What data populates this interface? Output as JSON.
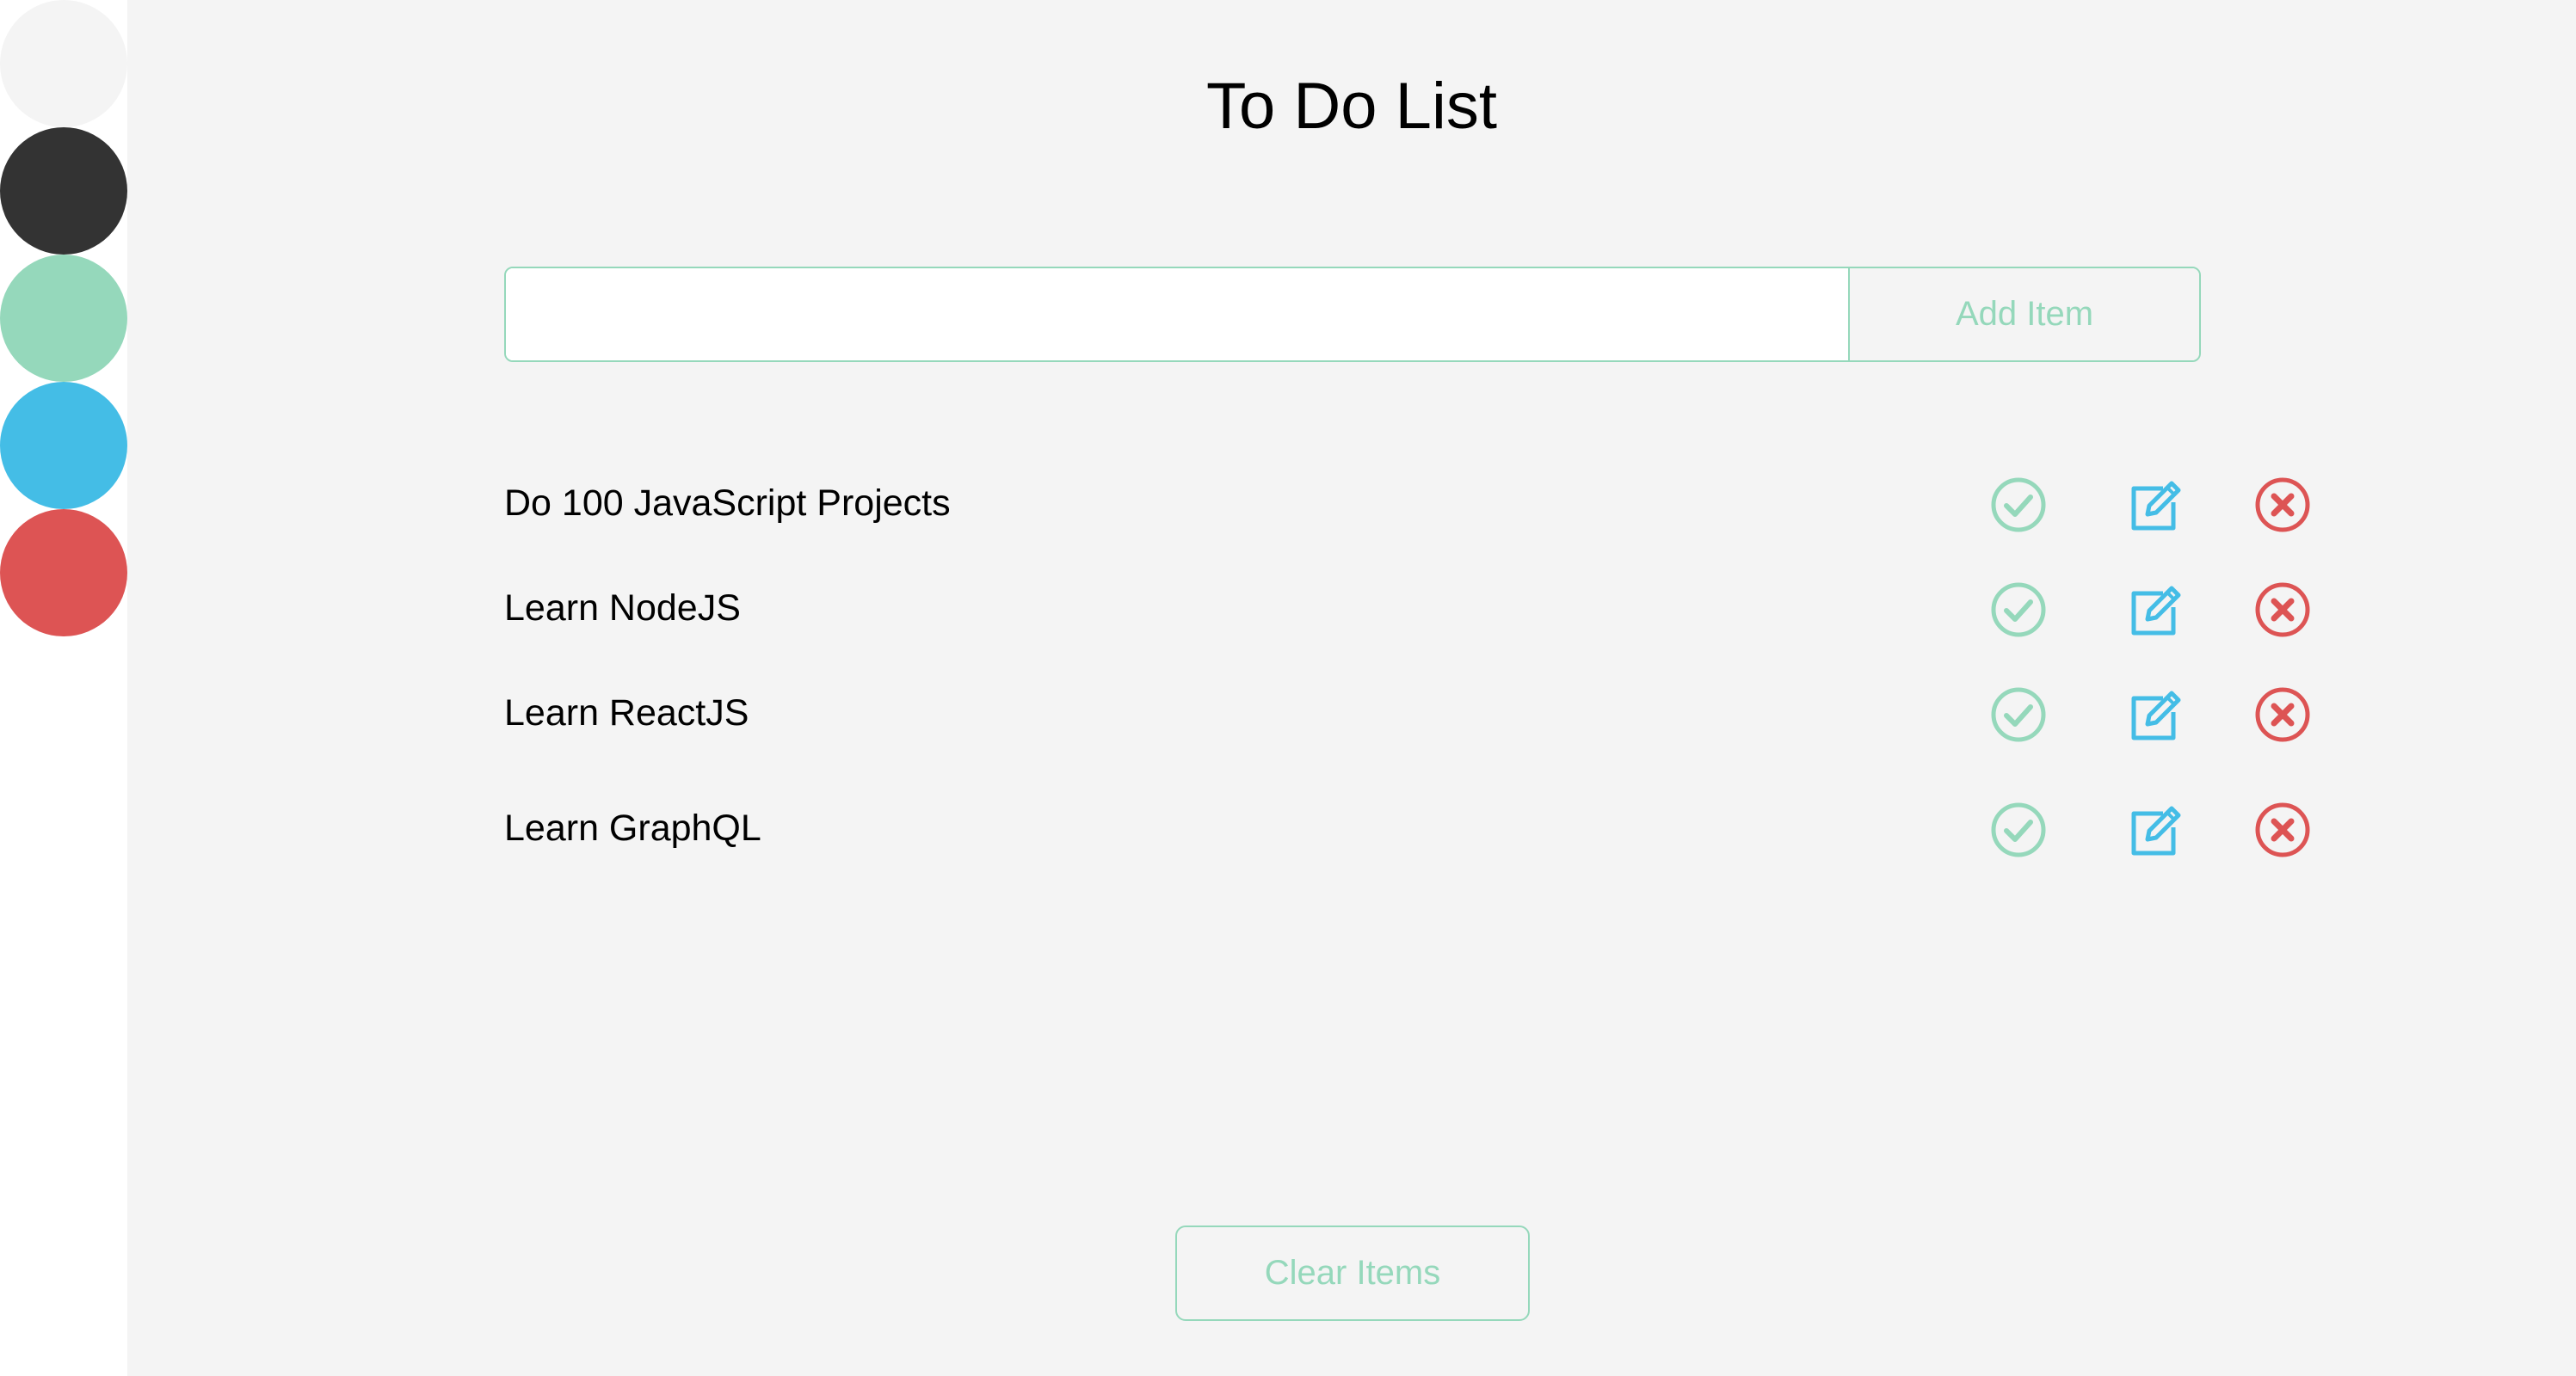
{
  "colors": {
    "background": "#f4f4f4",
    "accent_green": "#95d8bb",
    "accent_blue": "#44bde6",
    "accent_red": "#dd5454",
    "dark": "#333333",
    "light": "#f4f4f4"
  },
  "theme_swatches": [
    {
      "name": "light",
      "color": "#f4f4f4"
    },
    {
      "name": "dark",
      "color": "#333333"
    },
    {
      "name": "green",
      "color": "#95d8bb"
    },
    {
      "name": "blue",
      "color": "#44bde6"
    },
    {
      "name": "red",
      "color": "#dd5454"
    }
  ],
  "header": {
    "title": "To Do List"
  },
  "form": {
    "input_value": "",
    "input_placeholder": "",
    "add_button_label": "Add Item"
  },
  "todos": [
    {
      "text": "Do 100 JavaScript Projects",
      "icons": [
        "check-circle-icon",
        "edit-icon",
        "delete-circle-icon"
      ]
    },
    {
      "text": "Learn NodeJS",
      "icons": [
        "check-circle-icon",
        "edit-icon",
        "delete-circle-icon"
      ]
    },
    {
      "text": "Learn ReactJS",
      "icons": [
        "check-circle-icon",
        "edit-icon",
        "delete-circle-icon"
      ]
    },
    {
      "text": "Learn GraphQL",
      "icons": [
        "check-circle-icon",
        "edit-icon",
        "delete-circle-icon"
      ]
    }
  ],
  "footer": {
    "clear_button_label": "Clear Items"
  }
}
